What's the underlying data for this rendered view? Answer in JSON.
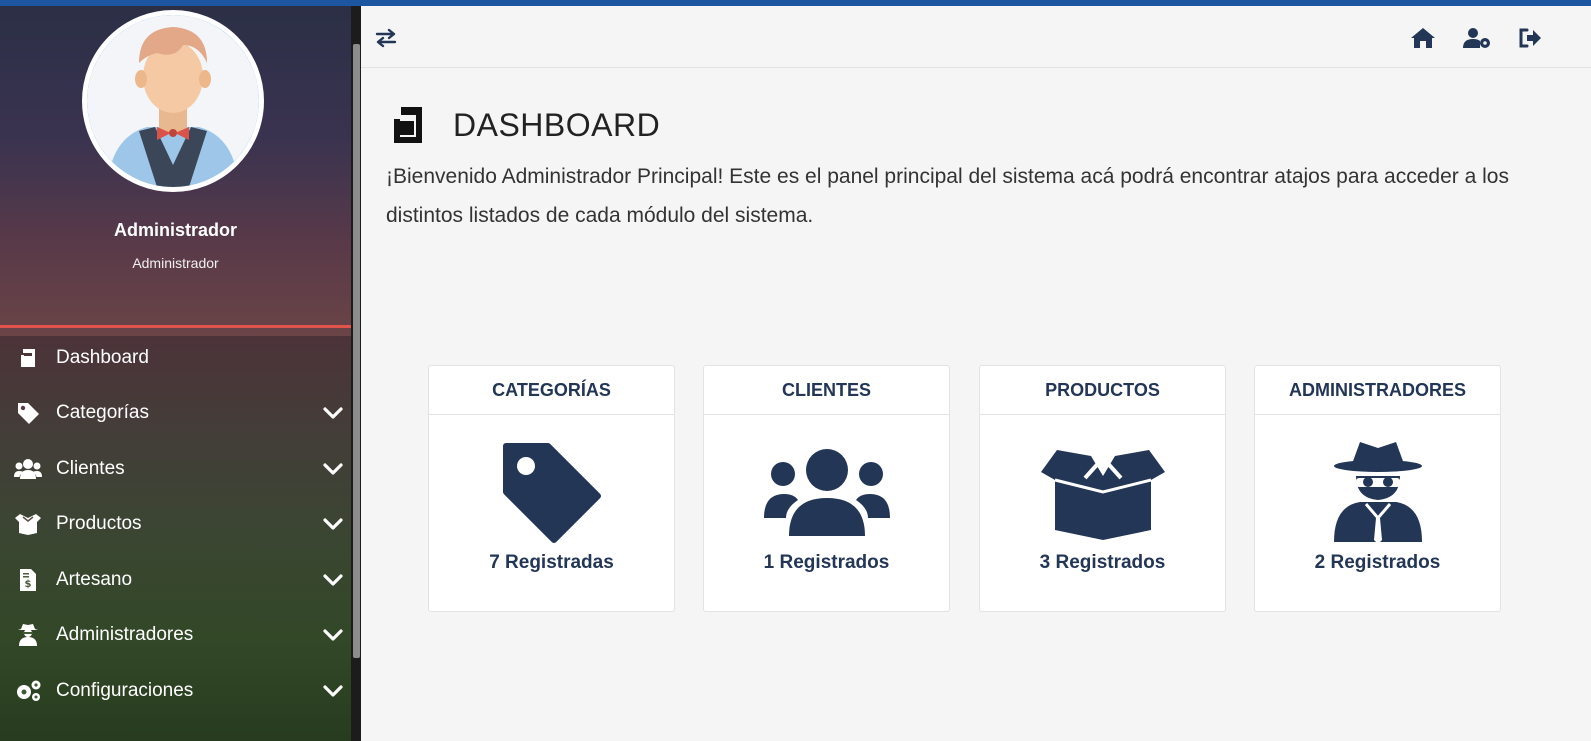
{
  "colors": {
    "accent_navy": "#233656",
    "sidebar_divider": "#e0544c",
    "top_strip": "#1d56a0"
  },
  "header": {
    "toggle_icon": "exchange-arrows-icon",
    "home_icon": "home-icon",
    "user_settings_icon": "user-gear-icon",
    "logout_icon": "sign-out-icon"
  },
  "profile": {
    "name": "Administrador",
    "role": "Administrador"
  },
  "sidebar": {
    "items": [
      {
        "label": "Dashboard",
        "icon": "dashboard-icon",
        "has_submenu": false
      },
      {
        "label": "Categorías",
        "icon": "tag-icon",
        "has_submenu": true
      },
      {
        "label": "Clientes",
        "icon": "users-icon",
        "has_submenu": true
      },
      {
        "label": "Productos",
        "icon": "box-open-icon",
        "has_submenu": true
      },
      {
        "label": "Artesano",
        "icon": "invoice-dollar-icon",
        "has_submenu": true
      },
      {
        "label": "Administradores",
        "icon": "user-secret-icon",
        "has_submenu": true
      },
      {
        "label": "Configuraciones",
        "icon": "cogs-icon",
        "has_submenu": true
      }
    ]
  },
  "main": {
    "title": "DASHBOARD",
    "welcome": "¡Bienvenido Administrador Principal! Este es el panel principal del sistema acá podrá encontrar atajos para acceder a los distintos listados de cada módulo del sistema.",
    "cards": [
      {
        "title": "CATEGORÍAS",
        "count_text": "7 Registradas",
        "icon": "tag-icon"
      },
      {
        "title": "CLIENTES",
        "count_text": "1 Registrados",
        "icon": "users-icon"
      },
      {
        "title": "PRODUCTOS",
        "count_text": "3 Registrados",
        "icon": "box-open-icon"
      },
      {
        "title": "ADMINISTRADORES",
        "count_text": "2 Registrados",
        "icon": "user-secret-icon"
      }
    ]
  }
}
